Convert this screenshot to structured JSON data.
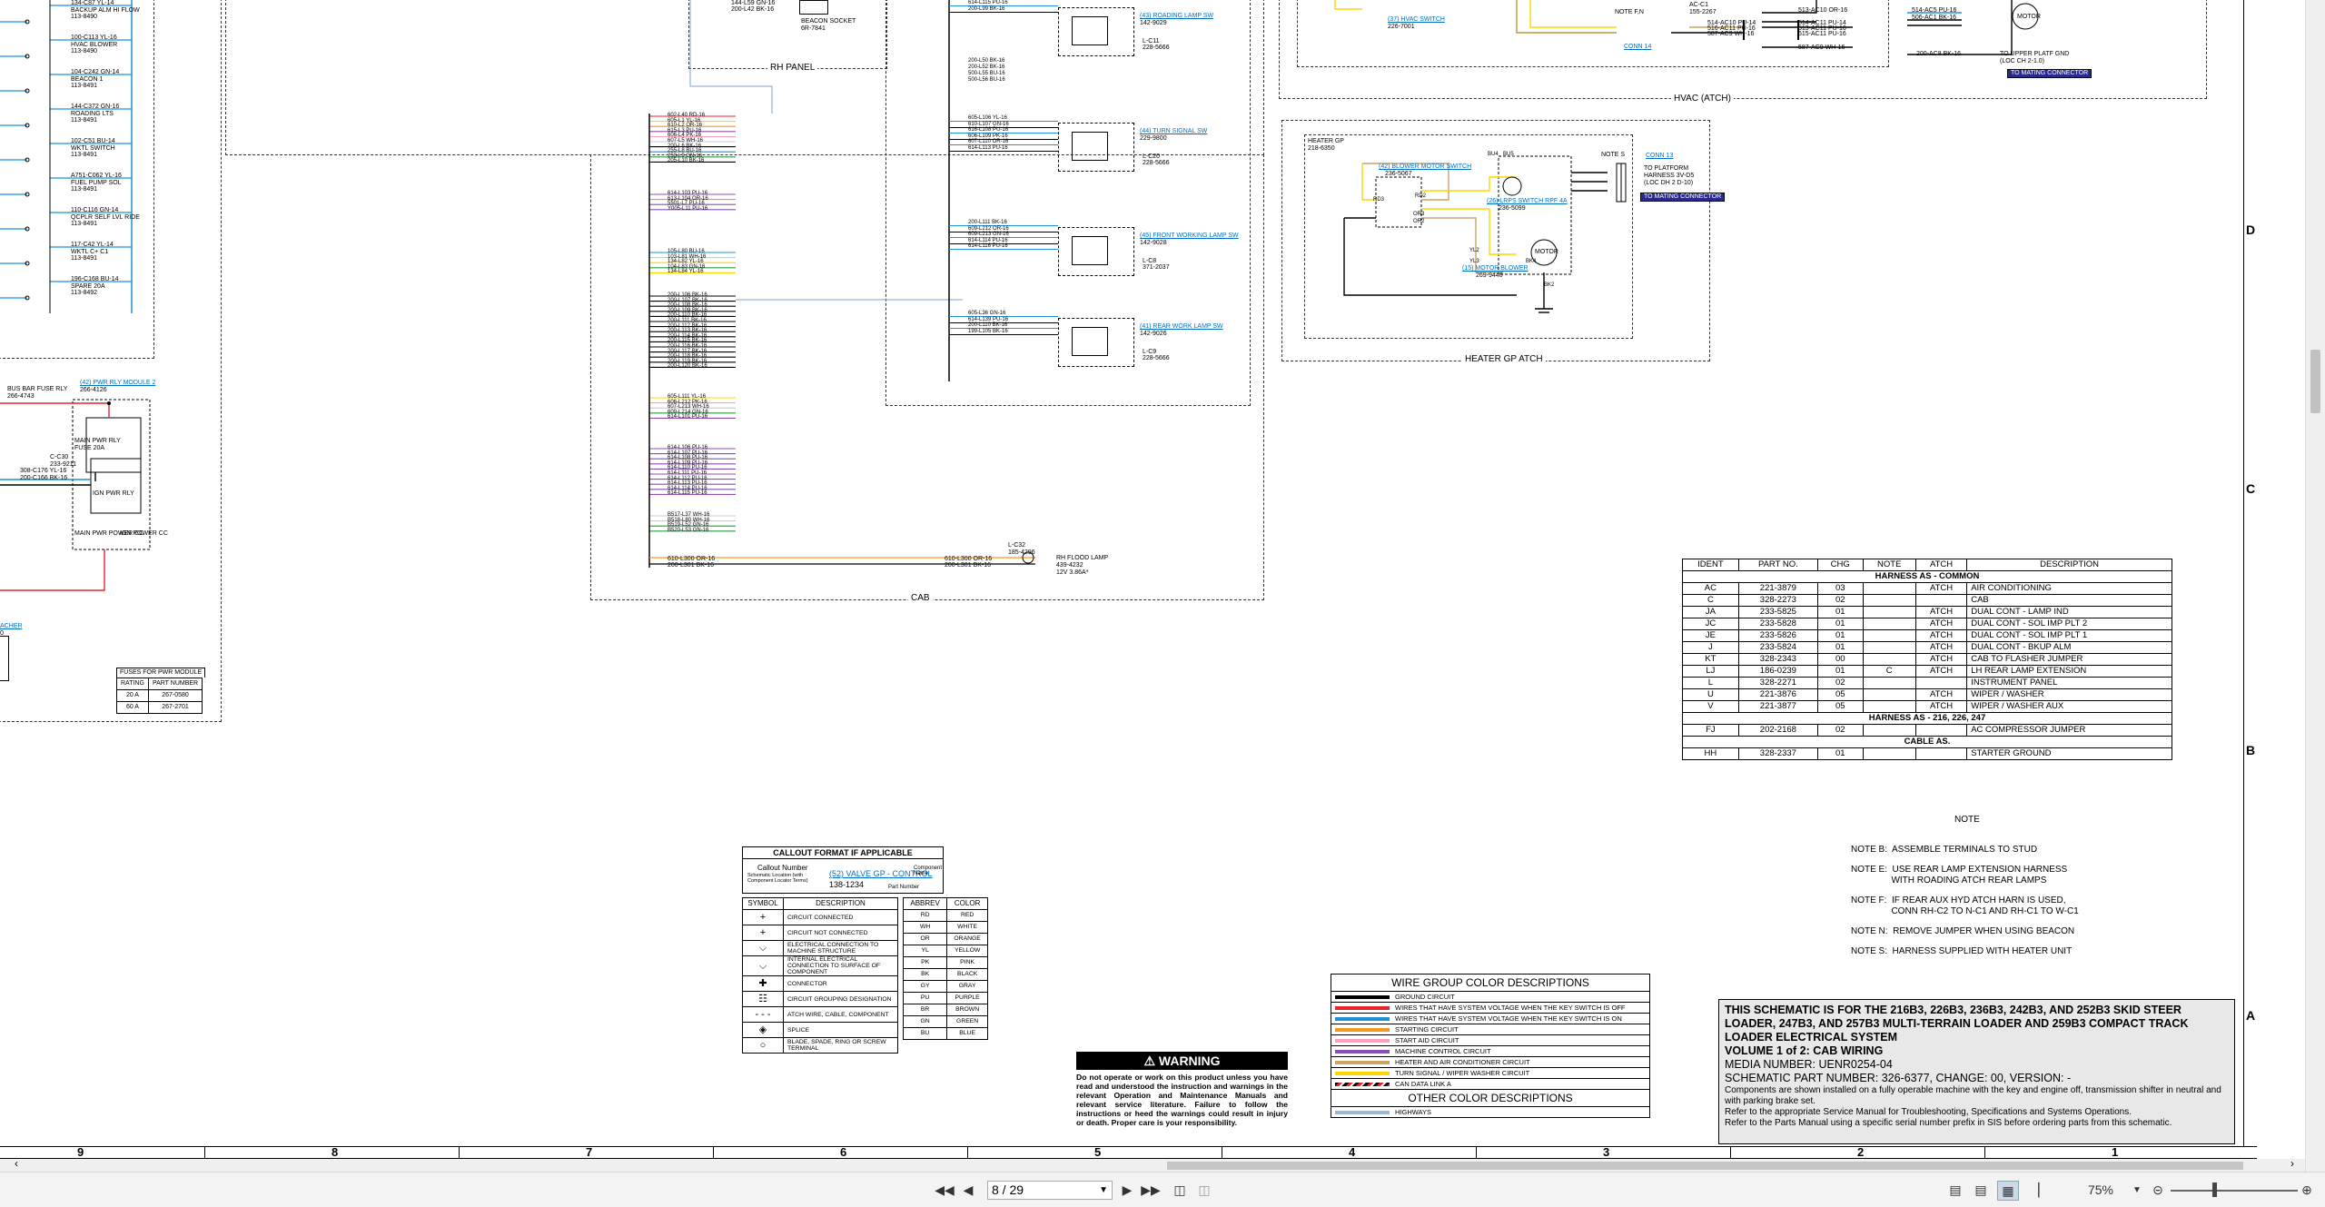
{
  "left_panel": {
    "components": [
      {
        "wire": "134-C87 YL-14",
        "name": "BACKUP ALM HI FLOW",
        "part": "113-8490"
      },
      {
        "wire": "100-C113 YL-16",
        "name": "HVAC BLOWER",
        "part": "113-8490"
      },
      {
        "wire": "104-C242 GN-14",
        "name": "BEACON 1",
        "part": "113-8491"
      },
      {
        "wire": "144-C372 GN-16",
        "name": "ROADING LTS",
        "part": "113-8491"
      },
      {
        "wire": "102-C51 BU-14",
        "name": "WKTL SWITCH",
        "part": "113-8491"
      },
      {
        "wire": "A751-C062 YL-16",
        "name": "FUEL PUMP SOL",
        "part": "113-8491"
      },
      {
        "wire": "110-C116 GN-14",
        "name": "QCPLR SELF LVL RIDE",
        "part": "113-8491"
      },
      {
        "wire": "117-C42 YL-14",
        "name": "WKTL C+ C1",
        "part": "113-8491"
      },
      {
        "wire": "196-C168 BU-14",
        "name": "SPARE 20A",
        "part": "113-8492"
      }
    ],
    "bus_bar": {
      "name": "BUS BAR FUSE RLY",
      "part": "266-4743"
    },
    "pwr_module_link": "(42) PWR RLY MODULE 2",
    "pwr_module_part": "266-4126",
    "relay_labels": [
      "MAIN PWR RLY",
      "IGN PWR RLY",
      "FUSE 20A",
      "MAIN PWR POWER CC",
      "IGN POWER CC"
    ],
    "connector": {
      "name": "C-C30",
      "part": "233-9211"
    },
    "relay_wires": [
      "308-C176 YL-16",
      "200-C166 BK-16"
    ],
    "edge_link": "ACHER",
    "edge_link2": "0",
    "fuses_table": {
      "title": "FUSES FOR PWR MODULE",
      "headers": [
        "RATING",
        "PART NUMBER"
      ],
      "rows": [
        [
          "20 A",
          "267-0580"
        ],
        [
          "60 A",
          "267-2701"
        ]
      ]
    }
  },
  "rh_panel": {
    "label": "RH PANEL",
    "wires_top": [
      "144-L59 GN-16",
      "200-L42 BK-16"
    ],
    "beacon_socket": {
      "name": "BEACON SOCKET",
      "part": "6R-7841"
    }
  },
  "cab": {
    "label": "CAB",
    "flood_lamp": {
      "wire_a": "610-L300 OR-16",
      "wire_b": "200-L301 BK-16",
      "name": "RH FLOOD LAMP",
      "part": "439-4232",
      "note": "12V 3.86A*"
    },
    "lc_label": "L-C32",
    "lc_part": "185-4296",
    "harness_wires_a": [
      "602-L40 RD-16",
      "605-L1 YL-16",
      "610-L2 OR-16",
      "615-L3 PU-16",
      "606-L4 PK-16",
      "607-L5 WH-16",
      "200-L6 BK-16",
      "255-L8 BU-16",
      "250-L9 GN-16",
      "205-L10 BK-16"
    ],
    "harness_wires_b": [
      "614-L103 PU-16",
      "613-L104 OR-16",
      "5501-L7 PU-16",
      "Y005-L11 PU-16"
    ],
    "harness_wires_c": [
      "105-L80 BU-16",
      "103-L81 WH-16",
      "134-L82 YL-16",
      "104-L83 GN-16",
      "134-L84 YL-16"
    ],
    "harness_wires_d": [
      "200-L106 BK-16",
      "200-L107 BK-16",
      "200-L108 BK-16",
      "200-L109 BK-16",
      "200-L110 BK-16",
      "200-L111 BK-16",
      "200-L112 BK-16",
      "200-L113 BK-16",
      "200-L114 BK-16",
      "200-L115 BK-16",
      "200-L116 BK-16",
      "200-L117 BK-16",
      "200-L118 BK-16",
      "200-L119 BK-16",
      "200-L120 BK-16"
    ],
    "harness_wires_e": [
      "605-L111 YL-16",
      "606-L212 PK-16",
      "607-L213 WH-16",
      "609-L214 GN-16",
      "614-L101 PU-16"
    ],
    "harness_wires_f": [
      "614-L106 PU-16",
      "614-L107 PU-16",
      "614-L108 PU-16",
      "614-L109 PU-16",
      "614-L110 PU-16",
      "614-L111 PU-16",
      "614-L112 PU-16",
      "614-L113 PU-16",
      "614-L114 PU-16",
      "614-L115 PU-16"
    ],
    "harness_wires_g": [
      "B517-L37 WH-16",
      "B518-L80 WH-16",
      "B519-L52 GN-16",
      "B520-L53 GN-16"
    ]
  },
  "switches": [
    {
      "link": "(43) ROADING LAMP SW",
      "part": "142-9029",
      "conn": "L-C11",
      "conn_part": "228-5666",
      "wires": [
        "614-L115 PU-16",
        "200-L99 BK-16"
      ]
    },
    {
      "link": "(44) TURN SIGNAL SW",
      "part": "229-9800",
      "conn": "L-C20",
      "conn_part": "228-5666",
      "wires": [
        "605-L106 YL-16",
        "610-L107 GN-16",
        "616-L108 PU-16",
        "606-L109 PK-16",
        "607-L110 OR-16",
        "614-L113 PU-16"
      ]
    },
    {
      "link": "(45) FRONT WORKING LAMP SW",
      "part": "142-9028",
      "conn": "L-C8",
      "conn_part": "371-2037",
      "wires": [
        "200-L111 BK-16",
        "609-L212 OR-16",
        "609-L213 GN-16",
        "614-L114 PU-16",
        "614-L116 PU-16"
      ]
    },
    {
      "link": "(41) REAR WORK LAMP SW",
      "part": "142-9026",
      "conn": "L-C9",
      "conn_part": "228-5666",
      "wires": [
        "605-L36 GN-16",
        "614-L139 PU-16",
        "200-L110 BK-16",
        "199-L105 BK-16"
      ]
    }
  ],
  "switch_group_wires": [
    "200-L50 BK-16",
    "200-L52 BK-16",
    "500-L55 BU-16",
    "500-L56 BU-16"
  ],
  "hvac": {
    "label": "HVAC (ATCH)",
    "hvac_switch_link": "(37) HVAC SWITCH",
    "hvac_switch_part": "226-7001",
    "conn14": "CONN 14",
    "note_label": "NOTE F,N",
    "ac_c1": "AC-C1",
    "ac_c1_part": "155-2267",
    "wires": [
      "514-AC10 PU-14",
      "516-AC11 PU-16",
      "515-AC11 PU-16",
      "587-AC9 WH-16",
      "513-AC10 OR-16",
      "514-AC11 PU-14",
      "513-AC11 PU-16",
      "587-AC9 WH-16",
      "514-AC5 PU-16",
      "506-AC1 BK-16",
      "200-AC8 BK-16"
    ],
    "motor": "MOTOR",
    "to_upper": "TO UPPER PLATF GND",
    "to_upper_loc": "(LOC CH 2-1.0)",
    "to_mating": "TO MATING CONNECTOR"
  },
  "heater": {
    "label": "HEATER GP ATCH",
    "heater_gp": "HEATER GP",
    "heater_part": "218-6350",
    "blower_sw_link": "(42) BLOWER MOTOR SWITCH",
    "blower_sw_part": "236-5067",
    "relay_link": "(26) LRPS SWITCH RPF 4A",
    "relay_part": "236-5099",
    "blower_link": "(15) MOTOR BLOWER",
    "blower_part": "269-9440",
    "motor": "MOTOR",
    "note": "NOTE S",
    "conn13": "CONN 13",
    "to_platform": "TO PLATFORM HARNESS 3V-D5 (LOC DH 2 D-10)",
    "to_mating": "TO MATING CONNECTOR",
    "wire_tags": [
      "RD3",
      "RD2",
      "BU4",
      "BU5",
      "OR3",
      "OR2",
      "YL2",
      "YL3",
      "BK4",
      "BK2"
    ]
  },
  "parts_table": {
    "headers": [
      "IDENT",
      "PART NO.",
      "CHG",
      "NOTE",
      "ATCH",
      "DESCRIPTION"
    ],
    "sections": [
      {
        "title": "HARNESS AS - COMMON",
        "rows": [
          [
            "AC",
            "221-3879",
            "03",
            "",
            "ATCH",
            "AIR CONDITIONING"
          ],
          [
            "C",
            "328-2273",
            "02",
            "",
            "",
            "CAB"
          ],
          [
            "JA",
            "233-5825",
            "01",
            "",
            "ATCH",
            "DUAL CONT - LAMP IND"
          ],
          [
            "JC",
            "233-5828",
            "01",
            "",
            "ATCH",
            "DUAL CONT - SOL IMP PLT 2"
          ],
          [
            "JE",
            "233-5826",
            "01",
            "",
            "ATCH",
            "DUAL CONT - SOL IMP PLT 1"
          ],
          [
            "J",
            "233-5824",
            "01",
            "",
            "ATCH",
            "DUAL CONT - BKUP ALM"
          ],
          [
            "KT",
            "328-2343",
            "00",
            "",
            "ATCH",
            "CAB TO FLASHER JUMPER"
          ],
          [
            "LJ",
            "186-0239",
            "01",
            "C",
            "ATCH",
            "LH REAR LAMP EXTENSION"
          ],
          [
            "L",
            "328-2271",
            "02",
            "",
            "",
            "INSTRUMENT PANEL"
          ],
          [
            "U",
            "221-3876",
            "05",
            "",
            "ATCH",
            "WIPER / WASHER"
          ],
          [
            "V",
            "221-3877",
            "05",
            "",
            "ATCH",
            "WIPER / WASHER AUX"
          ]
        ]
      },
      {
        "title": "HARNESS AS - 216, 226, 247",
        "rows": [
          [
            "FJ",
            "202-2168",
            "02",
            "",
            "",
            "AC COMPRESSOR JUMPER"
          ]
        ]
      },
      {
        "title": "CABLE AS.",
        "rows": [
          [
            "HH",
            "328-2337",
            "01",
            "",
            "",
            "STARTER GROUND"
          ]
        ]
      }
    ]
  },
  "notes": {
    "title": "NOTE",
    "items": [
      "NOTE B:  ASSEMBLE TERMINALS TO STUD",
      "NOTE E:  USE REAR LAMP EXTENSION HARNESS\n                WITH ROADING ATCH REAR LAMPS",
      "NOTE F:  IF REAR AUX HYD ATCH HARN IS USED,\n                CONN RH-C2 TO N-C1 AND RH-C1 TO W-C1",
      "NOTE N:  REMOVE JUMPER WHEN USING BEACON",
      "NOTE S:  HARNESS SUPPLIED WITH HEATER UNIT"
    ]
  },
  "callout_format": {
    "title": "CALLOUT FORMAT IF APPLICABLE",
    "callout_number": "Callout Number",
    "example_link": "(52) VALVE GP - CONTROL",
    "example_part": "138-1234",
    "component_name": "Component Name",
    "part_number": "Part Number",
    "location_note": "Schematic Location (with Component Locator Terms)"
  },
  "symbols": {
    "headers": [
      "SYMBOL",
      "DESCRIPTION"
    ],
    "rows": [
      "CIRCUIT CONNECTED",
      "CIRCUIT NOT CONNECTED",
      "ELECTRICAL CONNECTION TO MACHINE STRUCTURE",
      "INTERNAL ELECTRICAL CONNECTION TO SURFACE OF COMPONENT",
      "CONNECTOR",
      "CIRCUIT GROUPING DESIGNATION",
      "ATCH WIRE, CABLE, COMPONENT",
      "SPLICE",
      "BLADE, SPADE, RING OR SCREW TERMINAL"
    ]
  },
  "abbrev": {
    "headers": [
      "ABBREV",
      "COLOR"
    ],
    "rows": [
      [
        "RD",
        "RED"
      ],
      [
        "WH",
        "WHITE"
      ],
      [
        "OR",
        "ORANGE"
      ],
      [
        "YL",
        "YELLOW"
      ],
      [
        "PK",
        "PINK"
      ],
      [
        "BK",
        "BLACK"
      ],
      [
        "GY",
        "GRAY"
      ],
      [
        "PU",
        "PURPLE"
      ],
      [
        "BR",
        "BROWN"
      ],
      [
        "GN",
        "GREEN"
      ],
      [
        "BU",
        "BLUE"
      ]
    ]
  },
  "wire_groups": {
    "title": "WIRE GROUP COLOR DESCRIPTIONS",
    "rows": [
      {
        "color": "#000000",
        "label": "GROUND CIRCUIT"
      },
      {
        "color": "#e8232a",
        "label": "WIRES THAT HAVE SYSTEM VOLTAGE WHEN THE KEY SWITCH IS OFF"
      },
      {
        "color": "#1f8fd6",
        "label": "WIRES THAT HAVE SYSTEM VOLTAGE WHEN THE KEY SWITCH IS ON"
      },
      {
        "color": "#f39a1e",
        "label": "STARTING CIRCUIT"
      },
      {
        "color": "#ff9fbf",
        "label": "START AID CIRCUIT"
      },
      {
        "color": "#8b4fb3",
        "label": "MACHINE CONTROL CIRCUIT"
      },
      {
        "color": "#c9a567",
        "label": "HEATER AND AIR CONDITIONER CIRCUIT"
      },
      {
        "color": "#ffd700",
        "label": "TURN SIGNAL / WIPER WASHER CIRCUIT"
      },
      {
        "color": "stripe",
        "label": "CAN DATA LINK A"
      }
    ],
    "other_title": "OTHER COLOR DESCRIPTIONS",
    "other_rows": [
      {
        "color": "#9bb6d6",
        "label": "HIGHWAYS"
      }
    ]
  },
  "warning": {
    "title": "WARNING",
    "body": "Do not operate or work on this product unless you have read and understood the instruction and warnings in the relevant Operation and Maintenance Manuals and relevant service literature. Failure to follow the instructions or heed the warnings could result in injury or death. Proper care is your responsibility."
  },
  "title_block": {
    "line1": "THIS SCHEMATIC IS FOR THE 216B3, 226B3, 236B3, 242B3, AND 252B3 SKID STEER LOADER, 247B3, AND 257B3 MULTI-TERRAIN LOADER AND 259B3 COMPACT TRACK LOADER ELECTRICAL SYSTEM",
    "line2": "VOLUME 1 of 2: CAB WIRING",
    "line3": "MEDIA NUMBER: UENR0254-04",
    "line4": "SCHEMATIC PART NUMBER: 326-6377, CHANGE: 00, VERSION: -",
    "line5": "Components are shown installed on a fully operable machine with the key and engine off, transmission shifter in neutral and with parking brake set.",
    "line6": "Refer to the appropriate Service Manual for Troubleshooting, Specifications and Systems Operations.",
    "line7": "Refer to the Parts Manual using a specific serial number prefix in SIS before ordering parts from this schematic."
  },
  "grid": {
    "columns": [
      "9",
      "8",
      "7",
      "6",
      "5",
      "4",
      "3",
      "2",
      "1"
    ],
    "rows": [
      "D",
      "C",
      "B",
      "A"
    ]
  },
  "viewer": {
    "page_value": "8 / 29",
    "zoom": "75%",
    "accent": "#0070c0"
  }
}
